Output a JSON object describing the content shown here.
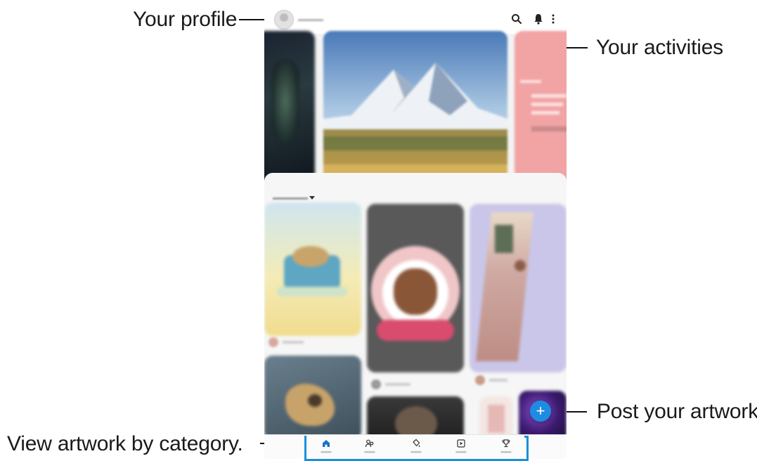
{
  "callouts": {
    "profile": "Your profile",
    "activities": "Your activities",
    "post": "Post your artwork.",
    "category": "View artwork by category."
  },
  "appbar": {
    "icons": [
      "search-icon",
      "bell-icon",
      "more-icon"
    ]
  },
  "fab": {
    "label": "+",
    "color": "#1e8ce0"
  },
  "navbar": {
    "icons": [
      "home-icon",
      "following-icon",
      "coloring-icon",
      "video-icon",
      "trophy-icon"
    ],
    "accent": "#1a90d9"
  }
}
